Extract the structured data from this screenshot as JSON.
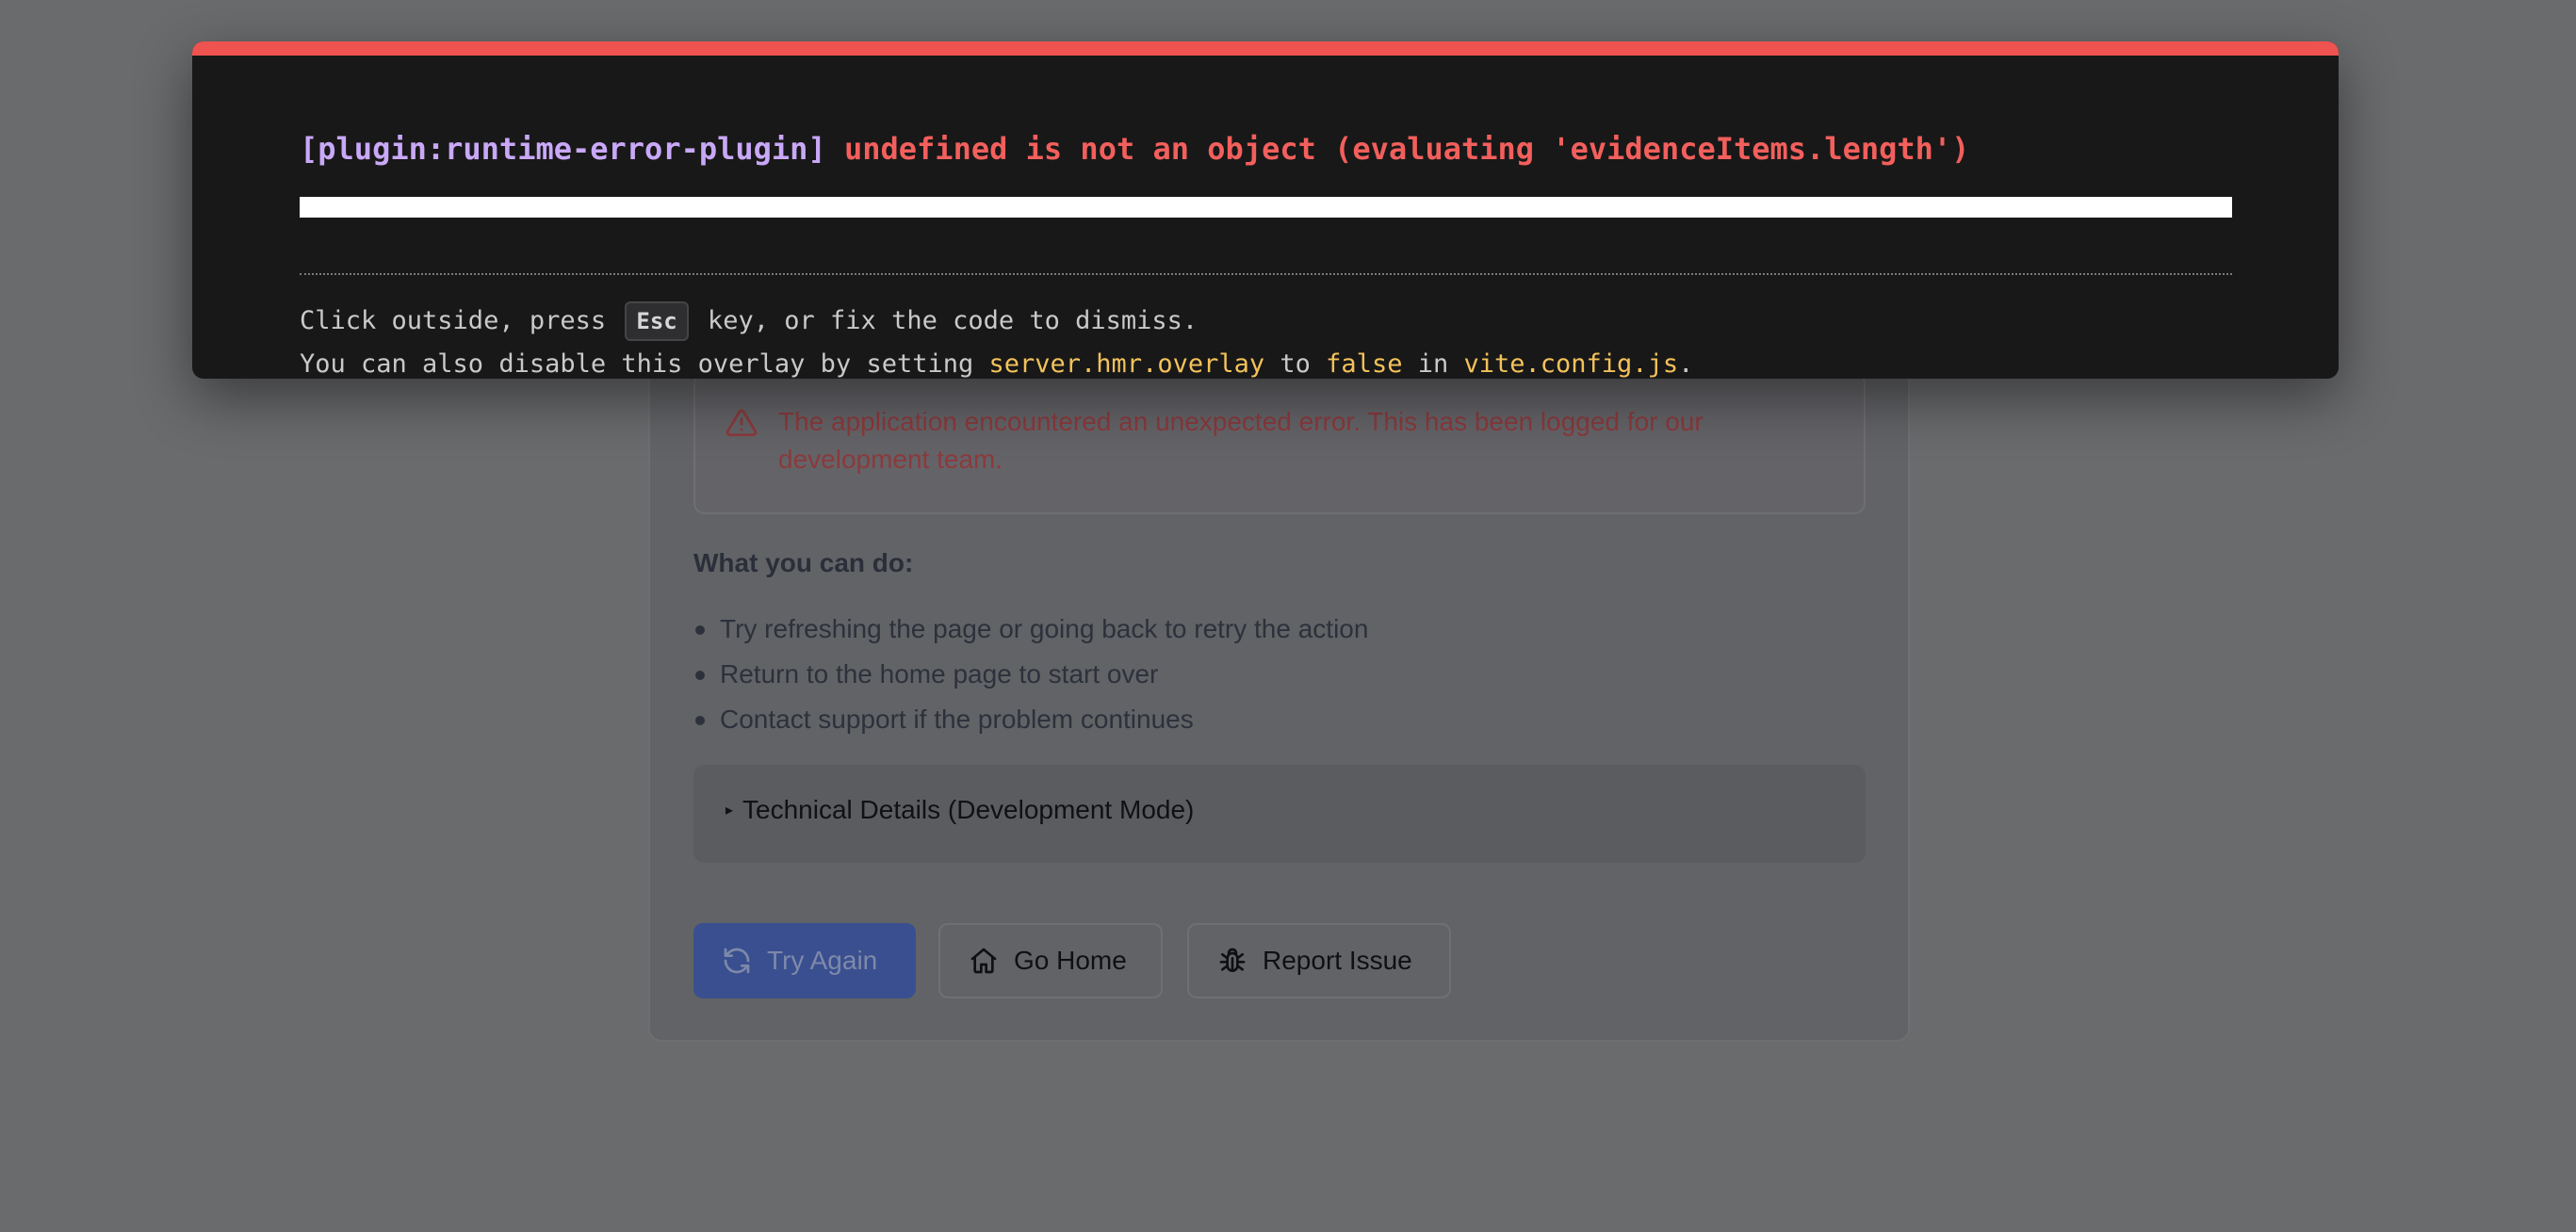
{
  "overlay": {
    "plugin": "[plugin:runtime-error-plugin]",
    "message": "undefined is not an object (evaluating 'evidenceItems.length')",
    "tip_line1_prefix": "Click outside, press",
    "tip_key": "Esc",
    "tip_line1_suffix": "key, or fix the code to dismiss.",
    "tip_line2_prefix": "You can also disable this overlay by setting",
    "tip_setting": "server.hmr.overlay",
    "tip_to": "to",
    "tip_false": "false",
    "tip_in": "in",
    "tip_file": "vite.config.js",
    "tip_end": ".",
    "colors": {
      "topbar": "#ef5350",
      "plugin": "#c9a8f8",
      "error": "#f25f5c",
      "code": "#f3c25a"
    }
  },
  "page": {
    "alert_icon": "warning-triangle-icon",
    "alert_message": "The application encountered an unexpected error. This has been logged for our development team.",
    "tips_heading": "What you can do:",
    "tips": [
      "Try refreshing the page or going back to retry the action",
      "Return to the home page to start over",
      "Contact support if the problem continues"
    ],
    "details_summary": "Technical Details (Development Mode)",
    "buttons": {
      "try_again": "Try Again",
      "go_home": "Go Home",
      "report_issue": "Report Issue"
    }
  }
}
